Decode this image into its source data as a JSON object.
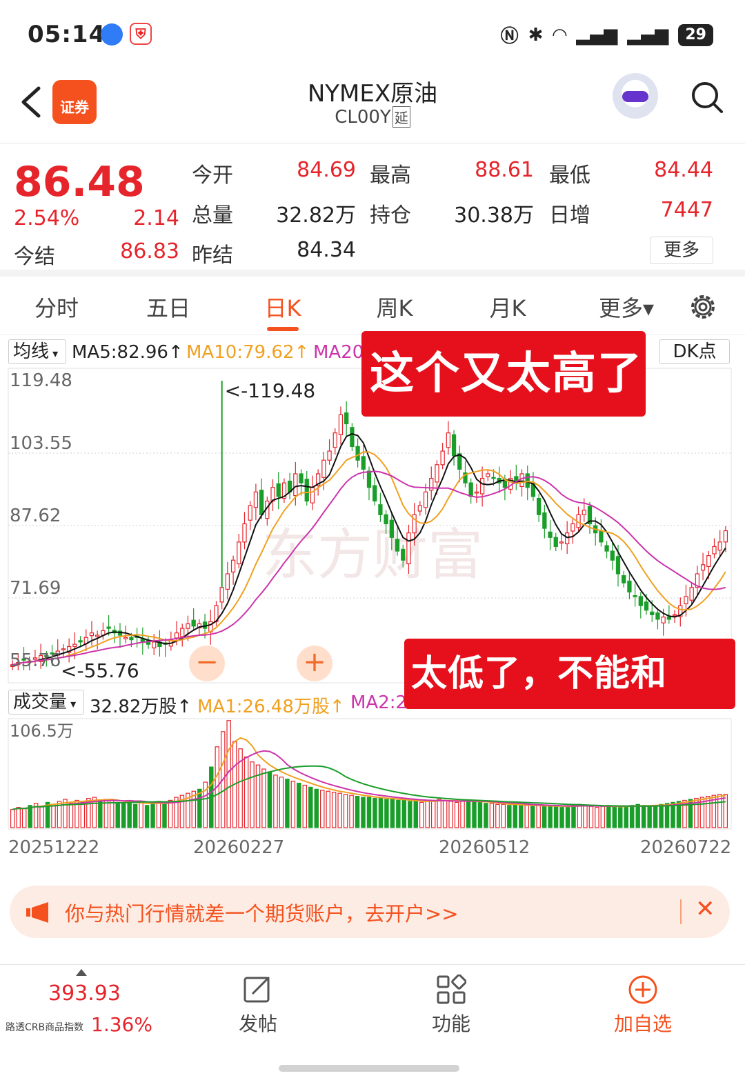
{
  "status_bar": {
    "time": "05:14",
    "battery": "29"
  },
  "header": {
    "title": "NYMEX原油",
    "code": "CL00Y",
    "code_tag": "延",
    "logo_text": "证券"
  },
  "quote": {
    "price": "86.48",
    "change_pct": "2.54%",
    "change": "2.14",
    "settle_label": "今结",
    "settle": "86.83",
    "open_label": "今开",
    "open": "84.69",
    "high_label": "最高",
    "high": "88.61",
    "low_label": "最低",
    "low": "84.44",
    "volume_label": "总量",
    "volume": "32.82万",
    "oi_label": "持仓",
    "oi": "30.38万",
    "daily_inc_label": "日增",
    "daily_inc": "7447",
    "prev_settle_label": "昨结",
    "prev_settle": "84.34",
    "more": "更多"
  },
  "tabs": [
    {
      "label": "分时"
    },
    {
      "label": "五日"
    },
    {
      "label": "日K"
    },
    {
      "label": "周K"
    },
    {
      "label": "月K"
    },
    {
      "label": "更多▾"
    }
  ],
  "ma_row": {
    "selector": "均线",
    "ma5": "MA5:82.96↑",
    "ma10": "MA10:79.62↑",
    "ma20": "MA20",
    "dk": "DK点"
  },
  "vol_row": {
    "selector": "成交量",
    "vol": "32.82万股↑",
    "ma1": "MA1:26.48万股↑",
    "ma2": "MA2:2"
  },
  "colors": {
    "up": "#e5242b",
    "down": "#1a9e2a",
    "ma5": "#111111",
    "ma10": "#f0a020",
    "ma20": "#cc33aa",
    "accent": "#f4511e"
  },
  "chart_data": {
    "type": "candlestick",
    "y_ticks": [
      "119.48",
      "103.55",
      "87.62",
      "71.69",
      "55.76"
    ],
    "ylim": [
      55.76,
      119.48
    ],
    "max_label": "<-119.48",
    "min_label": "<-55.76",
    "x_ticks": [
      "20251222",
      "20260227",
      "20260512",
      "20260722"
    ],
    "closes": [
      57,
      57.5,
      58,
      57.8,
      58.5,
      59,
      58.8,
      59.5,
      60,
      60.5,
      61,
      61.5,
      62,
      63,
      64,
      63.5,
      64.5,
      65,
      64,
      63.5,
      63,
      62.5,
      63,
      62,
      61.5,
      62,
      61,
      61.5,
      62.5,
      64,
      65,
      66,
      65.5,
      66,
      65,
      66.5,
      70,
      74,
      77,
      80,
      84,
      88,
      92,
      95,
      90,
      93,
      96,
      94,
      97,
      95,
      99,
      97,
      93,
      96,
      99,
      102,
      104,
      108,
      112,
      110,
      105,
      102,
      100,
      96,
      93,
      90,
      88,
      85,
      82,
      80,
      86,
      90,
      92,
      95,
      98,
      101,
      104,
      108,
      103,
      100,
      97,
      94,
      95,
      98,
      99,
      98,
      97,
      96,
      98,
      97,
      99,
      96,
      94,
      90,
      87,
      85,
      83,
      84,
      86,
      88,
      90,
      91,
      88,
      86,
      84,
      82,
      80,
      77,
      75,
      73,
      72,
      70,
      69,
      68,
      67,
      67.5,
      67,
      68,
      70,
      72,
      74,
      77,
      79,
      81,
      83,
      84,
      86.48
    ],
    "volume_ymax_label": "106.5万",
    "volumes": [
      18,
      20,
      19,
      22,
      24,
      21,
      25,
      23,
      26,
      28,
      24,
      27,
      25,
      29,
      30,
      26,
      28,
      27,
      25,
      24,
      26,
      23,
      25,
      22,
      24,
      26,
      23,
      27,
      30,
      32,
      34,
      36,
      38,
      45,
      60,
      80,
      95,
      106,
      85,
      78,
      70,
      65,
      62,
      58,
      55,
      52,
      50,
      48,
      46,
      44,
      42,
      40,
      38,
      37,
      36,
      35,
      34,
      33,
      32,
      31,
      30,
      30,
      29,
      29,
      28,
      28,
      27,
      27,
      26,
      26,
      25,
      26,
      27,
      28,
      27,
      26,
      25,
      26,
      27,
      26,
      25,
      24,
      24,
      23,
      23,
      22,
      23,
      22,
      22,
      21,
      22,
      21,
      22,
      21,
      20,
      21,
      22,
      23,
      22,
      21,
      20,
      21,
      22,
      21,
      20,
      21,
      22,
      23,
      22,
      21,
      22,
      23,
      24,
      25,
      26,
      27,
      28,
      29,
      30,
      31,
      32,
      33,
      32.82
    ]
  },
  "callouts": {
    "high": "这个又太高了",
    "low": "太低了，不能和平。"
  },
  "watermark": "东方财富",
  "ad": {
    "text": "你与热门行情就差一个期货账户，去开户>>"
  },
  "bottom": {
    "index_value": "393.93",
    "index_name": "路透CRB商品指数",
    "index_pct": "1.36%",
    "post": "发帖",
    "func": "功能",
    "add": "加自选"
  }
}
